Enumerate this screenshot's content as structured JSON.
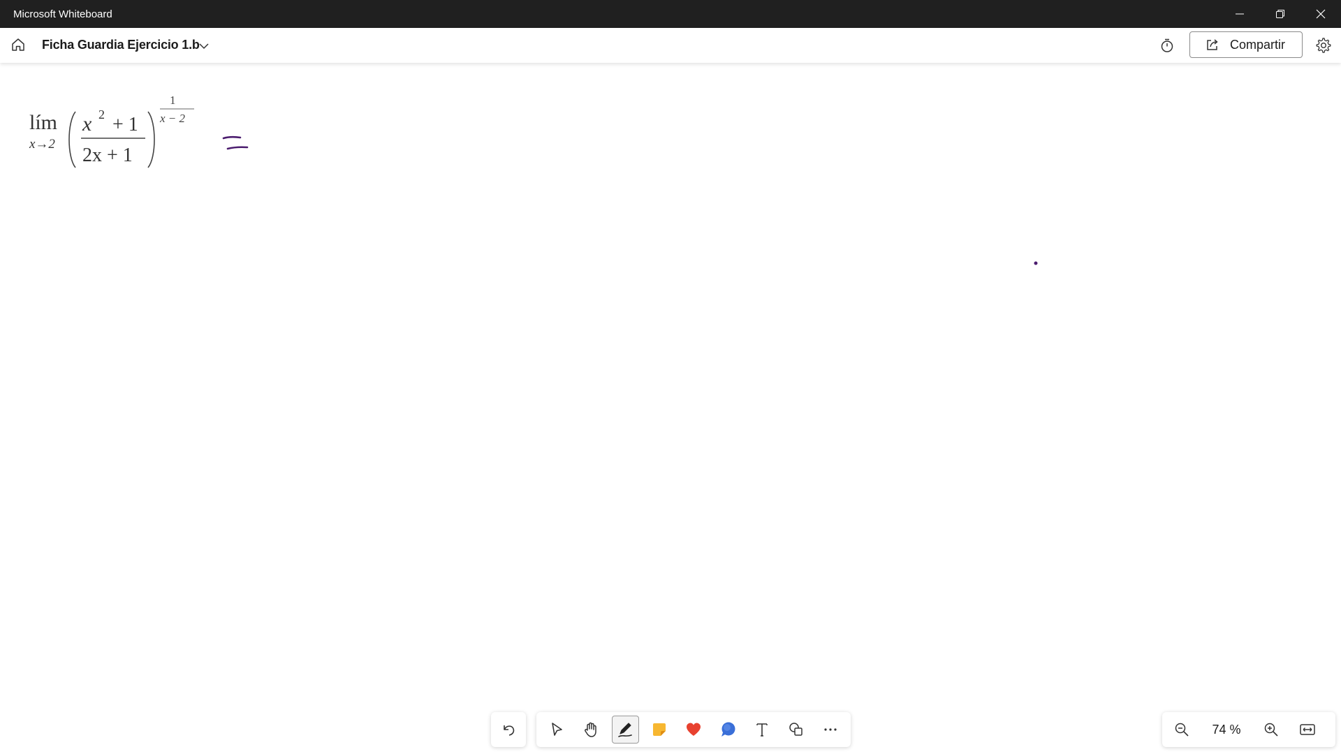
{
  "window": {
    "title": "Microsoft Whiteboard",
    "controls": [
      "minimize-icon",
      "restore-icon",
      "close-icon"
    ]
  },
  "header": {
    "board_title": "Ficha Guardia Ejercicio 1.b",
    "share_label": "Compartir",
    "icons": [
      "home-icon",
      "chevron-down-icon",
      "timer-icon",
      "share-icon",
      "gear-icon"
    ]
  },
  "canvas": {
    "math": {
      "lim": "lím",
      "sub": "x→2",
      "num_x": "x",
      "num_exp": "2",
      "num_rest": "+ 1",
      "den": "2x + 1",
      "exp_num": "1",
      "exp_den": "x − 2"
    },
    "ink_color": "#4b1c6e"
  },
  "toolbar": {
    "tools": [
      {
        "name": "undo",
        "icon": "undo-icon"
      },
      {
        "name": "select",
        "icon": "pointer-icon"
      },
      {
        "name": "pan",
        "icon": "hand-icon"
      },
      {
        "name": "pen",
        "icon": "pen-icon",
        "active": true
      },
      {
        "name": "sticky-note",
        "icon": "sticky-note-icon",
        "color": "#f7b731"
      },
      {
        "name": "reactions",
        "icon": "heart-icon",
        "color": "#e8412f"
      },
      {
        "name": "comments",
        "icon": "comment-icon",
        "color": "#3a6fd8"
      },
      {
        "name": "text",
        "icon": "text-icon"
      },
      {
        "name": "shapes",
        "icon": "shapes-icon"
      },
      {
        "name": "more",
        "icon": "more-icon"
      }
    ]
  },
  "zoom": {
    "level": "74 %",
    "icons": [
      "zoom-out-icon",
      "zoom-in-icon",
      "fit-to-screen-icon"
    ]
  }
}
